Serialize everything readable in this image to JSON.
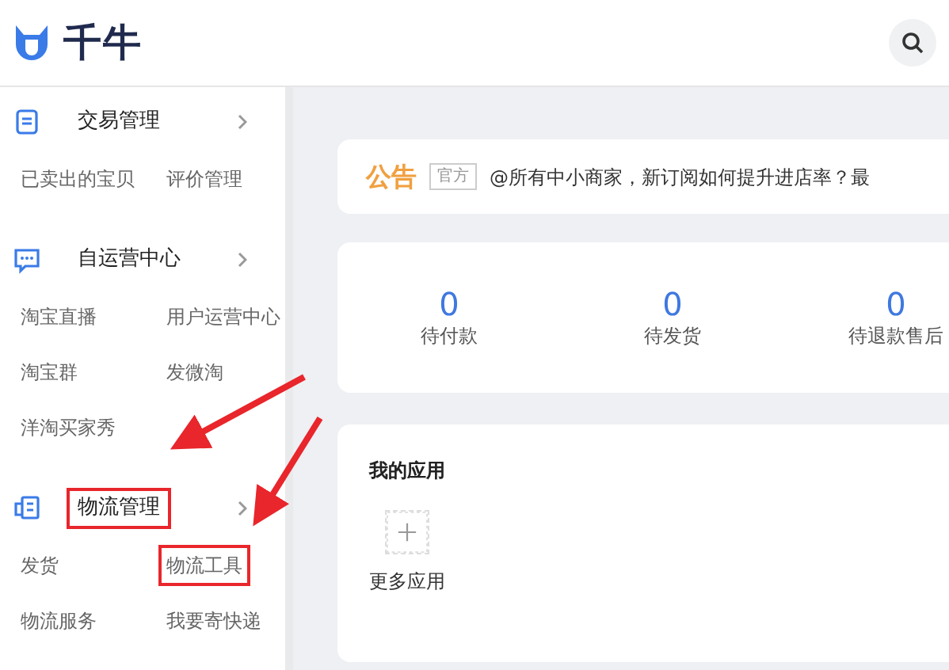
{
  "header": {
    "logo_text": "千牛"
  },
  "sidebar": {
    "sections": [
      {
        "title": "交易管理",
        "highlighted": false,
        "items": [
          {
            "label": "已卖出的宝贝",
            "highlighted": false
          },
          {
            "label": "评价管理",
            "highlighted": false
          }
        ]
      },
      {
        "title": "自运营中心",
        "highlighted": false,
        "items": [
          {
            "label": "淘宝直播",
            "highlighted": false
          },
          {
            "label": "用户运营中心",
            "highlighted": false
          },
          {
            "label": "淘宝群",
            "highlighted": false
          },
          {
            "label": "发微淘",
            "highlighted": false
          },
          {
            "label": "洋淘买家秀",
            "highlighted": false
          }
        ]
      },
      {
        "title": "物流管理",
        "highlighted": true,
        "items": [
          {
            "label": "发货",
            "highlighted": false
          },
          {
            "label": "物流工具",
            "highlighted": true
          },
          {
            "label": "物流服务",
            "highlighted": false
          },
          {
            "label": "我要寄快递",
            "highlighted": false
          }
        ]
      }
    ]
  },
  "notice": {
    "label": "公告",
    "tag": "官方",
    "text": "@所有中小商家，新订阅如何提升进店率？最"
  },
  "stats": [
    {
      "value": "0",
      "label": "待付款"
    },
    {
      "value": "0",
      "label": "待发货"
    },
    {
      "value": "0",
      "label": "待退款售后"
    }
  ],
  "apps": {
    "title": "我的应用",
    "items": [
      {
        "kind": "add",
        "label": "更多应用"
      }
    ]
  }
}
